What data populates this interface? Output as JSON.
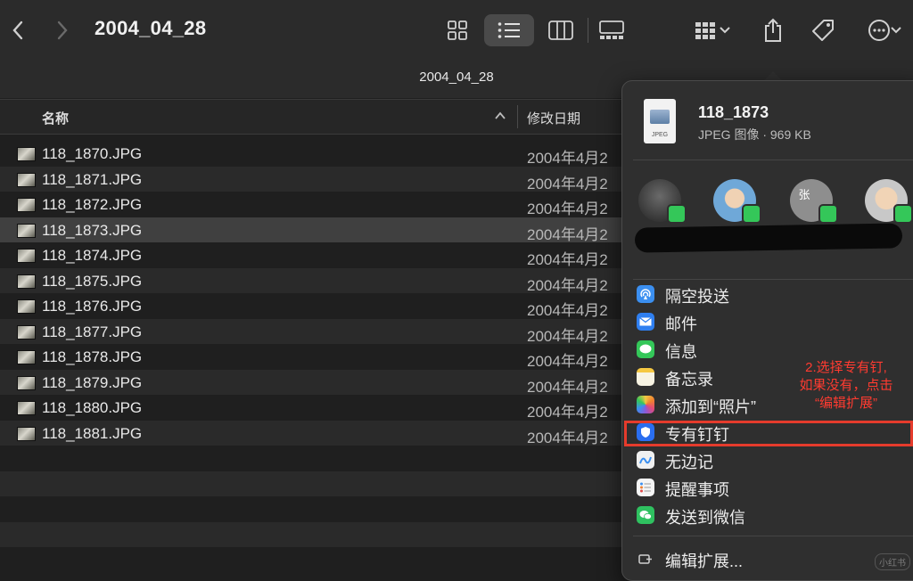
{
  "toolbar": {
    "title": "2004_04_28",
    "back_icon": "chevron-left-icon",
    "forward_icon": "chevron-right-icon",
    "view_icons": [
      "icon-view",
      "list-view",
      "column-view",
      "gallery-view"
    ],
    "active_view": "list-view",
    "group_icon": "group-icon",
    "share_icon": "share-icon",
    "tag_icon": "tag-icon",
    "more_icon": "more-icon"
  },
  "pathbar": {
    "label": "2004_04_28"
  },
  "columns": {
    "name": "名称",
    "date": "修改日期"
  },
  "files": [
    {
      "name": "118_1870.JPG",
      "date": "2004年4月2"
    },
    {
      "name": "118_1871.JPG",
      "date": "2004年4月2"
    },
    {
      "name": "118_1872.JPG",
      "date": "2004年4月2"
    },
    {
      "name": "118_1873.JPG",
      "date": "2004年4月2"
    },
    {
      "name": "118_1874.JPG",
      "date": "2004年4月2"
    },
    {
      "name": "118_1875.JPG",
      "date": "2004年4月2"
    },
    {
      "name": "118_1876.JPG",
      "date": "2004年4月2"
    },
    {
      "name": "118_1877.JPG",
      "date": "2004年4月2"
    },
    {
      "name": "118_1878.JPG",
      "date": "2004年4月2"
    },
    {
      "name": "118_1879.JPG",
      "date": "2004年4月2"
    },
    {
      "name": "118_1880.JPG",
      "date": "2004年4月2"
    },
    {
      "name": "118_1881.JPG",
      "date": "2004年4月2"
    }
  ],
  "share": {
    "file_name": "118_1873",
    "file_info": "JPEG 图像 · 969 KB",
    "file_icon_label": "JPEG",
    "contacts": [
      {
        "initial": ""
      },
      {
        "initial": ""
      },
      {
        "initial": "张"
      },
      {
        "initial": ""
      }
    ],
    "items": [
      {
        "label": "隔空投送",
        "icon": "airdrop-icon",
        "color": "#3b8ff0"
      },
      {
        "label": "邮件",
        "icon": "mail-icon",
        "color": "#2f7ff0"
      },
      {
        "label": "信息",
        "icon": "messages-icon",
        "color": "#34c759"
      },
      {
        "label": "备忘录",
        "icon": "notes-icon",
        "color": "#f5c842"
      },
      {
        "label": "添加到“照片”",
        "icon": "photos-icon",
        "color": "#f0a030"
      },
      {
        "label": "专有钉钉",
        "icon": "dingtalk-icon",
        "color": "#2a6ef0"
      },
      {
        "label": "无边记",
        "icon": "freeform-icon",
        "color": "#f0f0f0"
      },
      {
        "label": "提醒事项",
        "icon": "reminders-icon",
        "color": "#f5f5f5"
      },
      {
        "label": "发送到微信",
        "icon": "wechat-icon",
        "color": "#2fc160"
      }
    ],
    "edit_extensions": "编辑扩展...",
    "edit_icon": "extensions-icon"
  },
  "annotation": {
    "line1": "2.选择专有钉,",
    "line2": "如果没有，点击",
    "line3": "“编辑扩展”"
  },
  "watermark": "小红书",
  "colors": {
    "highlight": "#e53b2c",
    "annotation": "#ff3b30",
    "selected_row": "#404040"
  }
}
